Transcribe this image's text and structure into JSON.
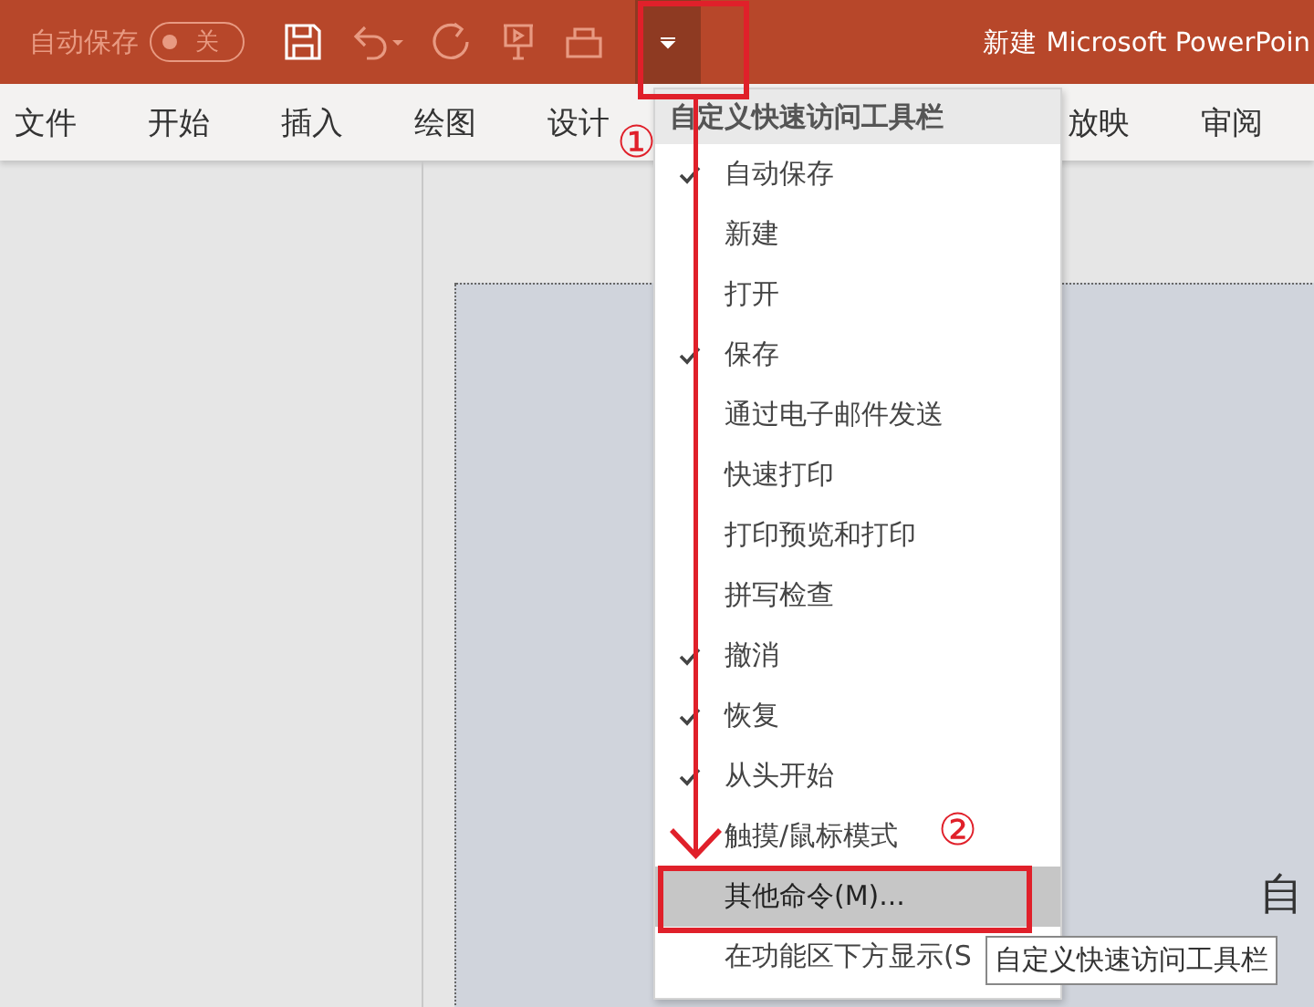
{
  "title_bar": {
    "autosave_label": "自动保存",
    "autosave_toggle": {
      "on": false,
      "label": "关"
    },
    "title": "新建 Microsoft PowerPoin"
  },
  "ribbon_tabs": [
    {
      "label": "文件",
      "selected": false
    },
    {
      "label": "开始",
      "selected": false
    },
    {
      "label": "插入",
      "selected": false
    },
    {
      "label": "绘图",
      "selected": false
    },
    {
      "label": "设计",
      "selected": false
    },
    {
      "label": "放映",
      "selected": false
    },
    {
      "label": "审阅",
      "selected": false
    }
  ],
  "slide": {
    "text": "自"
  },
  "menu": {
    "header": "自定义快速访问工具栏",
    "items": [
      {
        "label": "自动保存",
        "checked": true,
        "selected": false
      },
      {
        "label": "新建",
        "checked": false,
        "selected": false
      },
      {
        "label": "打开",
        "checked": false,
        "selected": false
      },
      {
        "label": "保存",
        "checked": true,
        "selected": false
      },
      {
        "label": "通过电子邮件发送",
        "checked": false,
        "selected": false
      },
      {
        "label": "快速打印",
        "checked": false,
        "selected": false
      },
      {
        "label": "打印预览和打印",
        "checked": false,
        "selected": false
      },
      {
        "label": "拼写检查",
        "checked": false,
        "selected": false
      },
      {
        "label": "撤消",
        "checked": true,
        "selected": false
      },
      {
        "label": "恢复",
        "checked": true,
        "selected": false
      },
      {
        "label": "从头开始",
        "checked": true,
        "selected": false
      },
      {
        "label": "触摸/鼠标模式",
        "checked": false,
        "selected": false
      },
      {
        "label": "其他命令(M)...",
        "checked": false,
        "selected": true
      },
      {
        "label": "在功能区下方显示(S",
        "checked": false,
        "selected": false
      }
    ]
  },
  "tooltip": "自定义快速访问工具栏",
  "annotations": [
    {
      "kind": "step",
      "text": "①"
    },
    {
      "kind": "step",
      "text": "②"
    }
  ]
}
